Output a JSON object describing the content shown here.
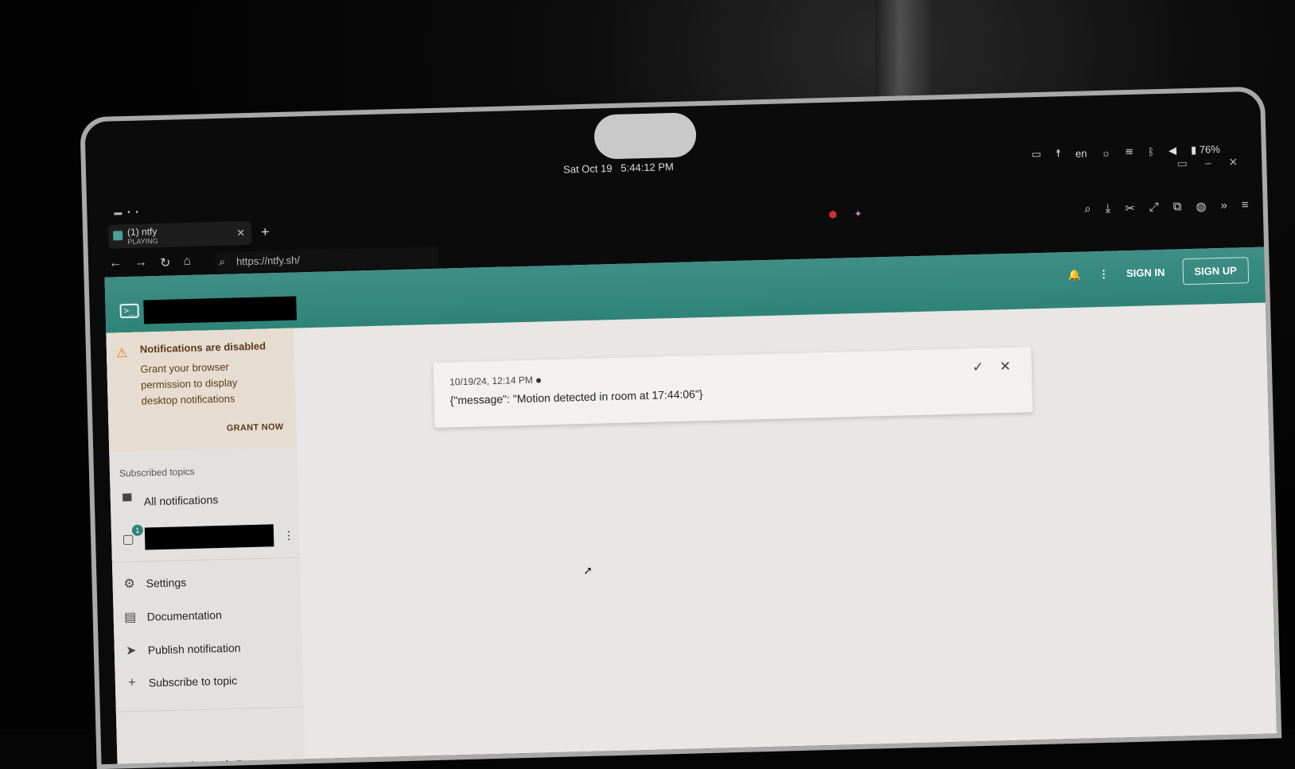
{
  "system": {
    "date": "Sat Oct 19",
    "time": "5:44:12 PM",
    "lang": "en",
    "battery": "76%"
  },
  "browser": {
    "tab_title": "(1) ntfy",
    "tab_status": "PLAYING",
    "url": "https://ntfy.sh/"
  },
  "header": {
    "sign_in": "SIGN IN",
    "sign_up": "SIGN UP"
  },
  "alert": {
    "title": "Notifications are disabled",
    "body": "Grant your browser permission to display desktop notifications",
    "action": "GRANT NOW"
  },
  "sidebar": {
    "section_title": "Subscribed topics",
    "all_notifications": "All notifications",
    "topic_badge": "1",
    "settings": "Settings",
    "documentation": "Documentation",
    "publish": "Publish notification",
    "subscribe": "Subscribe to topic",
    "upgrade": "Upgrade to ntfy Pro"
  },
  "notification": {
    "timestamp": "10/19/24, 12:14 PM",
    "message": "{\"message\": \"Motion detected in room at 17:44:06\"}"
  },
  "colors": {
    "accent": "#2e8377",
    "alert_bg": "#e6ddd0",
    "link": "#2b5fa8"
  }
}
